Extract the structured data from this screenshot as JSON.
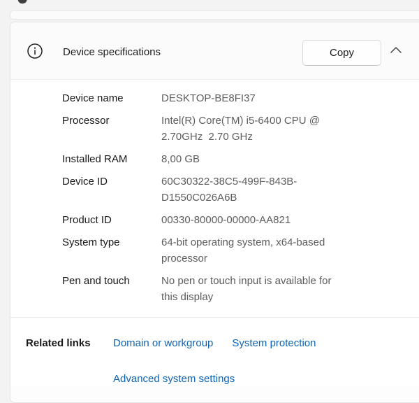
{
  "page": {
    "background": "#f3f3f3"
  },
  "card": {
    "header": {
      "title": "Device specifications",
      "leading_icon": "info-icon",
      "copy_button_label": "Copy",
      "collapse_icon": "chevron-up-icon"
    },
    "specs": [
      {
        "label": "Device name",
        "value": "DESKTOP-BE8FI37"
      },
      {
        "label": "Processor",
        "value": "Intel(R) Core(TM) i5-6400 CPU @\n2.70GHz  2.70 GHz"
      },
      {
        "label": "Installed RAM",
        "value": "8,00 GB"
      },
      {
        "label": "Device ID",
        "value": "60C30322-38C5-499F-843B-\nD1550C026A6B"
      },
      {
        "label": "Product ID",
        "value": "00330-80000-00000-AA821"
      },
      {
        "label": "System type",
        "value": "64-bit operating system, x64-based\nprocessor"
      },
      {
        "label": "Pen and touch",
        "value": "No pen or touch input is available for\nthis display"
      }
    ],
    "related": {
      "label": "Related links",
      "links": [
        {
          "label": "Domain or workgroup"
        },
        {
          "label": "System protection"
        },
        {
          "label": "Advanced system settings"
        }
      ]
    }
  },
  "colors": {
    "link": "#0b63b6",
    "label_text": "#191919",
    "value_text": "#5d5d5d",
    "card_background": "#fdfdfd",
    "card_border": "#e5e5e5",
    "page_background": "#f3f3f3"
  }
}
